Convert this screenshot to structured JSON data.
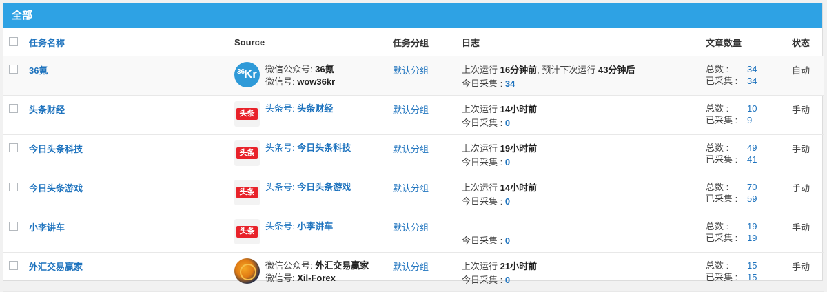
{
  "panel": {
    "title": "全部"
  },
  "columns": {
    "name": "任务名称",
    "source": "Source",
    "group": "任务分组",
    "log": "日志",
    "count": "文章数量",
    "status": "状态"
  },
  "rows": [
    {
      "name": "36氪",
      "logo": "36kr-logo",
      "source_line1_label": "微信公众号:",
      "source_line1_value": "36氪",
      "source_line2_label": "微信号:",
      "source_line2_value": "wow36kr",
      "group": "默认分组",
      "log_prefix": "上次运行",
      "log_last": "16分钟前",
      "log_mid": ", 预计下次运行",
      "log_next": "43分钟后",
      "today_label": "今日采集 :",
      "today_value": "34",
      "total_label": "总数 :",
      "total": "34",
      "collected_label": "已采集 :",
      "collected": "34",
      "status": "自动"
    },
    {
      "name": "头条财经",
      "logo": "toutiao-logo",
      "source_line1_label": "头条号:",
      "source_line1_value": "头条财经",
      "group": "默认分组",
      "log_prefix": "上次运行",
      "log_last": "14小时前",
      "today_label": "今日采集 :",
      "today_value": "0",
      "total_label": "总数 :",
      "total": "10",
      "collected_label": "已采集 :",
      "collected": "9",
      "status": "手动"
    },
    {
      "name": "今日头条科技",
      "logo": "toutiao-logo",
      "source_line1_label": "头条号:",
      "source_line1_value": "今日头条科技",
      "group": "默认分组",
      "log_prefix": "上次运行",
      "log_last": "19小时前",
      "today_label": "今日采集 :",
      "today_value": "0",
      "total_label": "总数 :",
      "total": "49",
      "collected_label": "已采集 :",
      "collected": "41",
      "status": "手动"
    },
    {
      "name": "今日头条游戏",
      "logo": "toutiao-logo",
      "source_line1_label": "头条号:",
      "source_line1_value": "今日头条游戏",
      "group": "默认分组",
      "log_prefix": "上次运行",
      "log_last": "14小时前",
      "today_label": "今日采集 :",
      "today_value": "0",
      "total_label": "总数 :",
      "total": "70",
      "collected_label": "已采集 :",
      "collected": "59",
      "status": "手动"
    },
    {
      "name": "小李讲车",
      "logo": "toutiao-logo",
      "source_line1_label": "头条号:",
      "source_line1_value": "小李讲车",
      "group": "默认分组",
      "today_label": "今日采集 :",
      "today_value": "0",
      "total_label": "总数 :",
      "total": "19",
      "collected_label": "已采集 :",
      "collected": "19",
      "status": "手动"
    },
    {
      "name": "外汇交易赢家",
      "logo": "forex-logo",
      "source_line1_label": "微信公众号:",
      "source_line1_value": "外汇交易赢家",
      "source_line2_label": "微信号:",
      "source_line2_value": "Xil-Forex",
      "group": "默认分组",
      "log_prefix": "上次运行",
      "log_last": "21小时前",
      "today_label": "今日采集 :",
      "today_value": "0",
      "total_label": "总数 :",
      "total": "15",
      "collected_label": "已采集 :",
      "collected": "15",
      "status": "手动"
    }
  ],
  "logo_text": {
    "kr_small": "36",
    "kr_big": "Kr",
    "toutiao": "头条"
  },
  "colors": {
    "header_bg": "#2ea2e4",
    "link": "#1e73be"
  }
}
